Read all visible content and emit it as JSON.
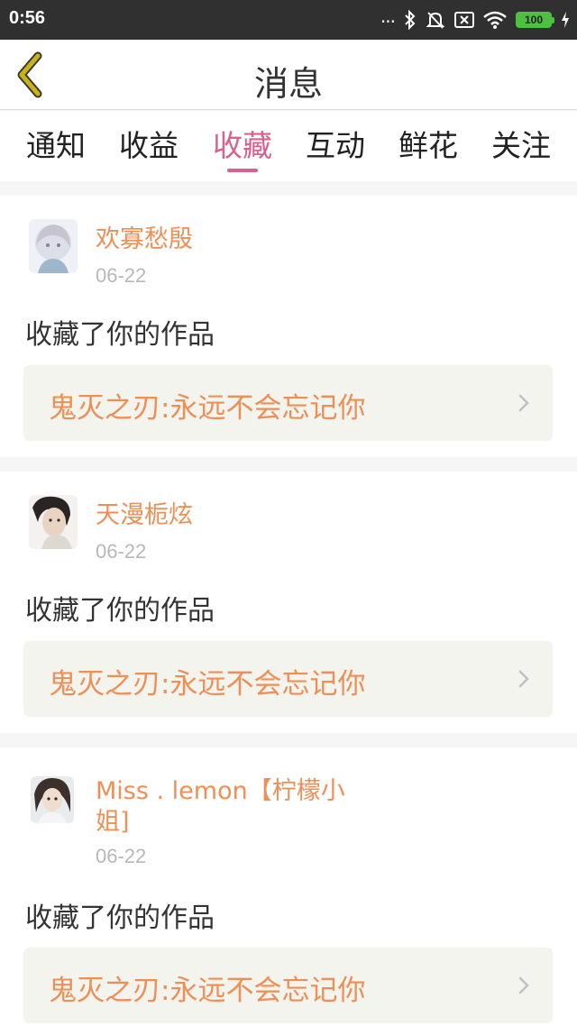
{
  "status_bar": {
    "time": "0:56",
    "dots": "...",
    "battery": "100"
  },
  "header": {
    "title": "消息"
  },
  "tabs": [
    {
      "label": "通知"
    },
    {
      "label": "收益"
    },
    {
      "label": "收藏"
    },
    {
      "label": "互动"
    },
    {
      "label": "鲜花"
    },
    {
      "label": "关注"
    }
  ],
  "active_tab": "收藏",
  "messages": [
    {
      "username": "欢寡愁殷",
      "date": "06-22",
      "action": "收藏了你的作品",
      "work_title": "鬼灭之刃:永远不会忘记你"
    },
    {
      "username": "天漫栀炫",
      "date": "06-22",
      "action": "收藏了你的作品",
      "work_title": "鬼灭之刃:永远不会忘记你"
    },
    {
      "username": "Miss . lemon【柠檬小姐]",
      "date": "06-22",
      "action": "收藏了你的作品",
      "work_title": "鬼灭之刃:永远不会忘记你"
    }
  ],
  "colors": {
    "accent": "#d9608f",
    "username": "#ef8f55",
    "back_arrow": "#c9b21c"
  }
}
